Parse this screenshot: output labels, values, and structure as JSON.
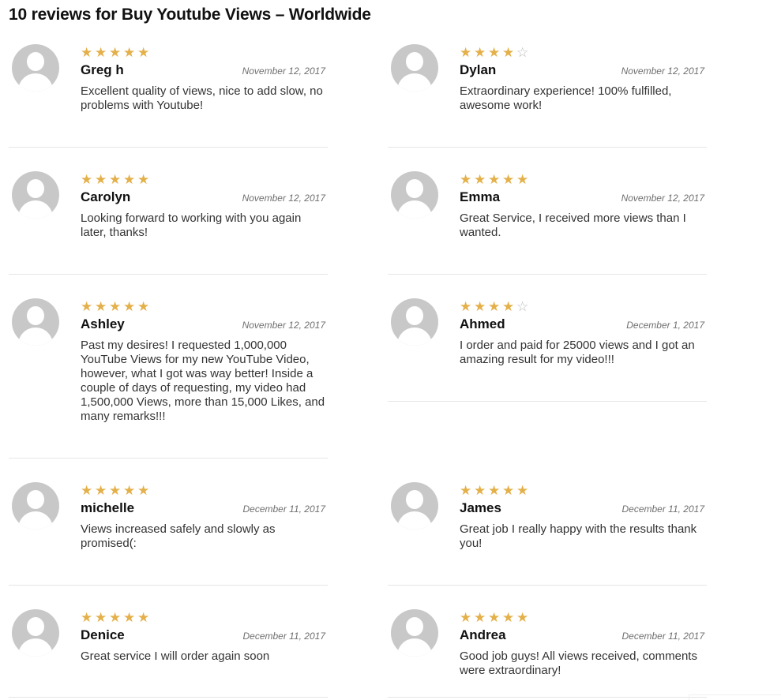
{
  "heading": "10 reviews for Buy Youtube Views – Worldwide",
  "colors": {
    "star_filled": "#e4b04a",
    "star_empty": "#b9b9b9",
    "avatar": "#c8c8c8"
  },
  "icons": {
    "avatar": "default-avatar-icon",
    "star": "star-icon"
  },
  "reviews": [
    {
      "name": "Greg h",
      "date": "November 12, 2017",
      "rating": 5,
      "text": "Excellent quality of views, nice to add slow, no problems with Youtube!"
    },
    {
      "name": "Dylan",
      "date": "November 12, 2017",
      "rating": 4,
      "text": "Extraordinary experience! 100% fulfilled, awesome work!"
    },
    {
      "name": "Carolyn",
      "date": "November 12, 2017",
      "rating": 5,
      "text": "Looking forward to working with you again later, thanks!"
    },
    {
      "name": "Emma",
      "date": "November 12, 2017",
      "rating": 5,
      "text": "Great Service, I received more views than I wanted."
    },
    {
      "name": "Ashley",
      "date": "November 12, 2017",
      "rating": 5,
      "text": "Past my desires! I requested 1,000,000 YouTube Views for my new YouTube Video, however, what I got was way better! Inside a couple of days of requesting, my video had 1,500,000 Views, more than 15,000 Likes, and many remarks!!!"
    },
    {
      "name": "Ahmed",
      "date": "December 1, 2017",
      "rating": 4,
      "text": "I order and paid for 25000 views and I got an amazing result for my video!!!"
    },
    {
      "name": "michelle",
      "date": "December 11, 2017",
      "rating": 5,
      "text": "Views increased safely and slowly as promised(:"
    },
    {
      "name": "James",
      "date": "December 11, 2017",
      "rating": 5,
      "text": "Great job I really happy with the results thank you!"
    },
    {
      "name": "Denice",
      "date": "December 11, 2017",
      "rating": 5,
      "text": "Great service I will order again soon"
    },
    {
      "name": "Andrea",
      "date": "December 11, 2017",
      "rating": 5,
      "text": "Good job guys! All views received, comments were extraordinary!"
    }
  ]
}
